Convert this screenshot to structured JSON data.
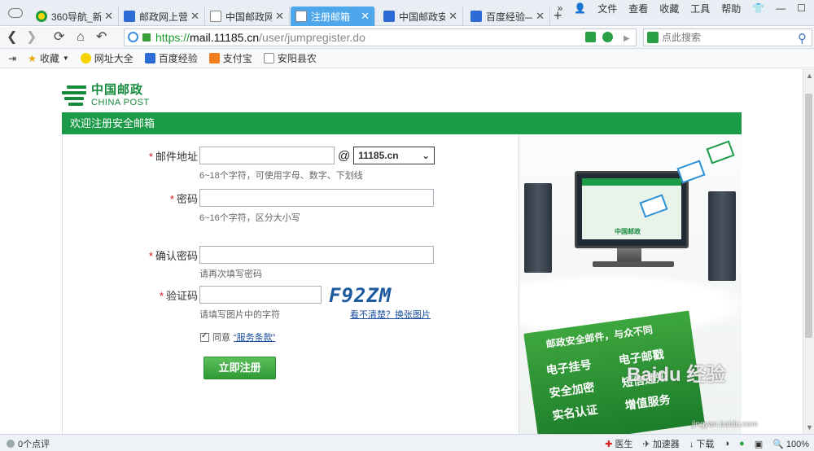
{
  "browser": {
    "tabs": [
      {
        "label": "360导航_新",
        "icon": "360-icon"
      },
      {
        "label": "邮政网上营",
        "icon": "paw-icon"
      },
      {
        "label": "中国邮政网",
        "icon": "page-icon"
      },
      {
        "label": "注册邮箱",
        "icon": "page-icon",
        "active": true
      },
      {
        "label": "中国邮政安",
        "icon": "paw-icon"
      },
      {
        "label": "百度经验—",
        "icon": "paw-icon"
      }
    ],
    "menu": [
      "文件",
      "查看",
      "收藏",
      "工具",
      "帮助"
    ],
    "url": {
      "scheme": "https://",
      "host": "mail.11185.cn",
      "path": "/user/jumpregister.do"
    },
    "search_placeholder": "点此搜索",
    "favorites": [
      "收藏",
      "网址大全",
      "百度经验",
      "支付宝",
      "安阳县农"
    ]
  },
  "page": {
    "logo": {
      "cn": "中国邮政",
      "en": "CHINA POST"
    },
    "header": "欢迎注册安全邮箱",
    "form": {
      "email": {
        "label": "邮件地址",
        "hint": "6~18个字符，可使用字母、数字、下划线",
        "at": "@",
        "domain": "11185.cn"
      },
      "password": {
        "label": "密码",
        "hint": "6~16个字符，区分大小写"
      },
      "confirm": {
        "label": "确认密码",
        "hint": "请再次填写密码"
      },
      "captcha": {
        "label": "验证码",
        "hint": "请填写图片中的字符",
        "code": "F92ZM",
        "refresh": "看不清楚？换张图片"
      },
      "agree": {
        "prefix": "同意",
        "link": "“服务条款”"
      },
      "submit": "立即注册"
    },
    "promo": {
      "slogan": "邮政安全邮件，与众不同",
      "features": [
        "电子挂号",
        "电子邮戳",
        "安全加密",
        "短信通知",
        "实名认证",
        "增值服务"
      ]
    },
    "watermark": "Baidu 经验",
    "watermark_url": "jingyan.baidu.com"
  },
  "statusbar": {
    "left": "0个点评",
    "right": [
      "医生",
      "加速器",
      "下载",
      "100%"
    ]
  },
  "colors": {
    "brand_green": "#1b9a48",
    "tab_active": "#4ea7ea",
    "required": "#d11111"
  }
}
